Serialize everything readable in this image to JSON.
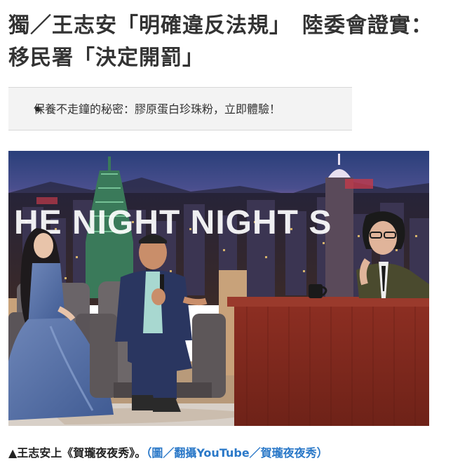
{
  "article": {
    "headline": "獨／王志安「明確違反法規」　陸委會證實：移民署「決定開罰」"
  },
  "promo": {
    "items": [
      {
        "label": "保養不走鐘的秘密：膠原蛋白珍珠粉，立即體驗！"
      }
    ]
  },
  "photo": {
    "sign_text": "HE NIGHT NIGHT S"
  },
  "caption": {
    "main": "▲王志安上《賀瓏夜夜秀》。",
    "credit": "（圖／翻攝YouTube／賀瓏夜夜秀）"
  }
}
